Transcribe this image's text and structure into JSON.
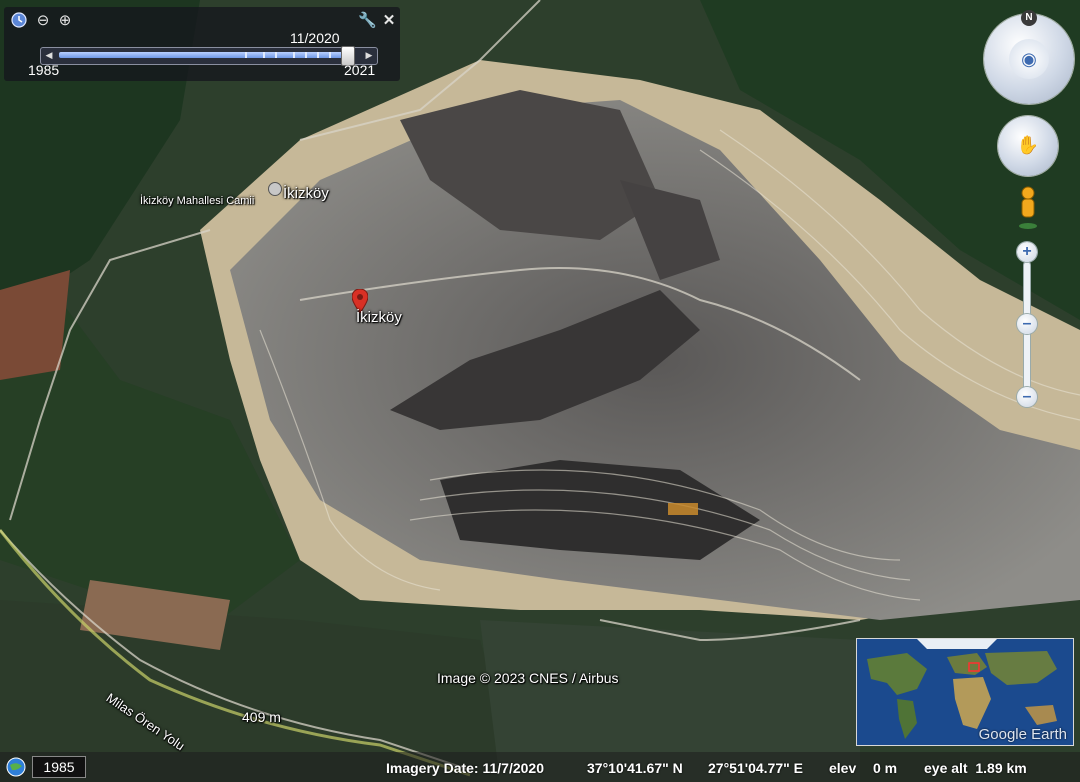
{
  "timeslider": {
    "current_date": "11/2020",
    "start_year": "1985",
    "end_year": "2021",
    "position_fraction": 0.96
  },
  "places": {
    "village_label": "İkizköy",
    "mosque_label": "İkizköy Mahallesi Camii",
    "pin_label": "İkizköy",
    "road_label": "Milas Ören Yolu"
  },
  "scale": {
    "label": "409 m"
  },
  "attribution": "Image © 2023 CNES / Airbus",
  "status": {
    "historical_year": "1985",
    "imagery_date": "Imagery Date: 11/7/2020",
    "latitude": "37°10'41.67\" N",
    "longitude": "27°51'04.77\" E",
    "elev_label": "elev",
    "elev_value": "0 m",
    "eye_alt": "eye alt  1.89 km"
  },
  "compass": {
    "north": "N"
  },
  "logo": "Google Earth",
  "colors": {
    "forest": "#1f3a24",
    "mine_gray": "#8c8c88",
    "coal": "#3c3a3a",
    "benches": "#c8b998",
    "pin_red": "#d93025"
  }
}
